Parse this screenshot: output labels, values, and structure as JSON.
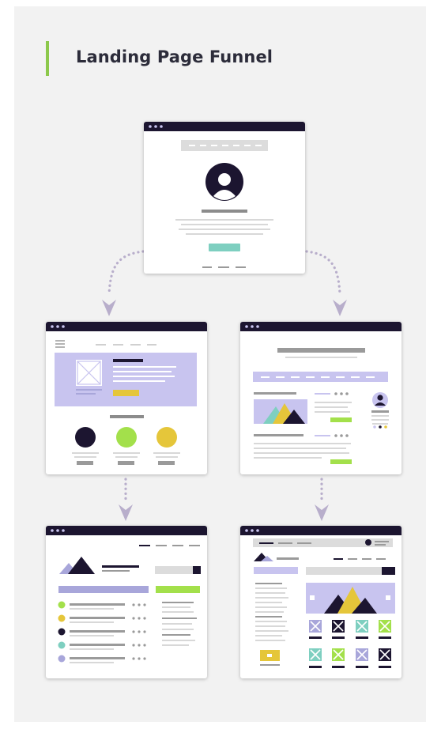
{
  "header": {
    "title": "Landing Page Funnel"
  },
  "colors": {
    "accent_bar": "#8cc84b",
    "titlebar": "#1c1530",
    "lavender": "#c8c4ef",
    "lavender_dark": "#a8a6da",
    "lime": "#a3e04b",
    "yellow": "#e5c63a",
    "teal": "#7ecfc0",
    "gray": "#9a9a9a",
    "light_gray": "#dcdcdc",
    "connector": "#b8aecb"
  },
  "diagram": {
    "nodes": [
      {
        "id": "landing-page",
        "icon": "profile-page"
      },
      {
        "id": "product-page",
        "icon": "hero-page"
      },
      {
        "id": "article-page",
        "icon": "blog-page"
      },
      {
        "id": "list-page",
        "icon": "list-page"
      },
      {
        "id": "gallery-page",
        "icon": "gallery-page"
      }
    ],
    "edges": [
      {
        "from": "landing-page",
        "to": "product-page"
      },
      {
        "from": "landing-page",
        "to": "article-page"
      },
      {
        "from": "product-page",
        "to": "list-page"
      },
      {
        "from": "article-page",
        "to": "gallery-page"
      }
    ]
  }
}
